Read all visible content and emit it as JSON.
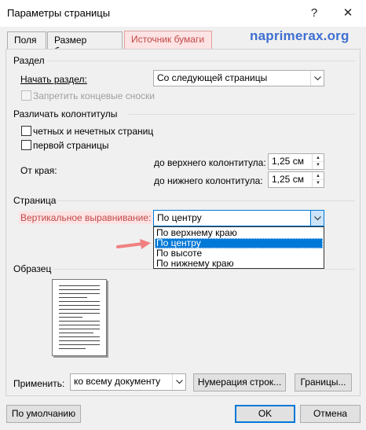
{
  "window": {
    "title": "Параметры страницы",
    "help_glyph": "?",
    "close_glyph": "✕"
  },
  "tabs": [
    {
      "label": "Поля",
      "active": false
    },
    {
      "label": "Размер бумаги",
      "active": false
    },
    {
      "label": "Источник бумаги",
      "active": true
    }
  ],
  "watermark": "naprimerax.org",
  "section": {
    "group_label": "Раздел",
    "start_label": "Начать раздел:",
    "start_value": "Со следующей страницы",
    "suppress_endnotes_label": "Запретить концевые сноски",
    "suppress_endnotes_checked": false
  },
  "headers_footers": {
    "group_label": "Различать колонтитулы",
    "odd_even_label": "четных и нечетных страниц",
    "odd_even_checked": false,
    "first_page_label": "первой страницы",
    "first_page_checked": false,
    "from_edge_label": "От края:",
    "header_label": "до верхнего колонтитула:",
    "header_value": "1,25 см",
    "footer_label": "до нижнего колонтитула:",
    "footer_value": "1,25 см"
  },
  "page": {
    "group_label": "Страница",
    "vertical_align_label": "Вертикальное выравнивание:",
    "vertical_align_value": "По центру",
    "options": [
      "По верхнему краю",
      "По центру",
      "По высоте",
      "По нижнему краю"
    ],
    "selected_index": 1
  },
  "preview": {
    "group_label": "Образец"
  },
  "apply": {
    "label": "Применить:",
    "value": "ко всему документу",
    "line_numbers_button": "Нумерация строк...",
    "borders_button": "Границы..."
  },
  "footer": {
    "default_button": "По умолчанию",
    "ok_button": "OK",
    "cancel_button": "Отмена"
  },
  "colors": {
    "accent": "#0078d7",
    "highlight_bg": "#fde3e3",
    "highlight_text": "#c04848",
    "arrow": "#f08080",
    "watermark": "#3f6fd0"
  }
}
